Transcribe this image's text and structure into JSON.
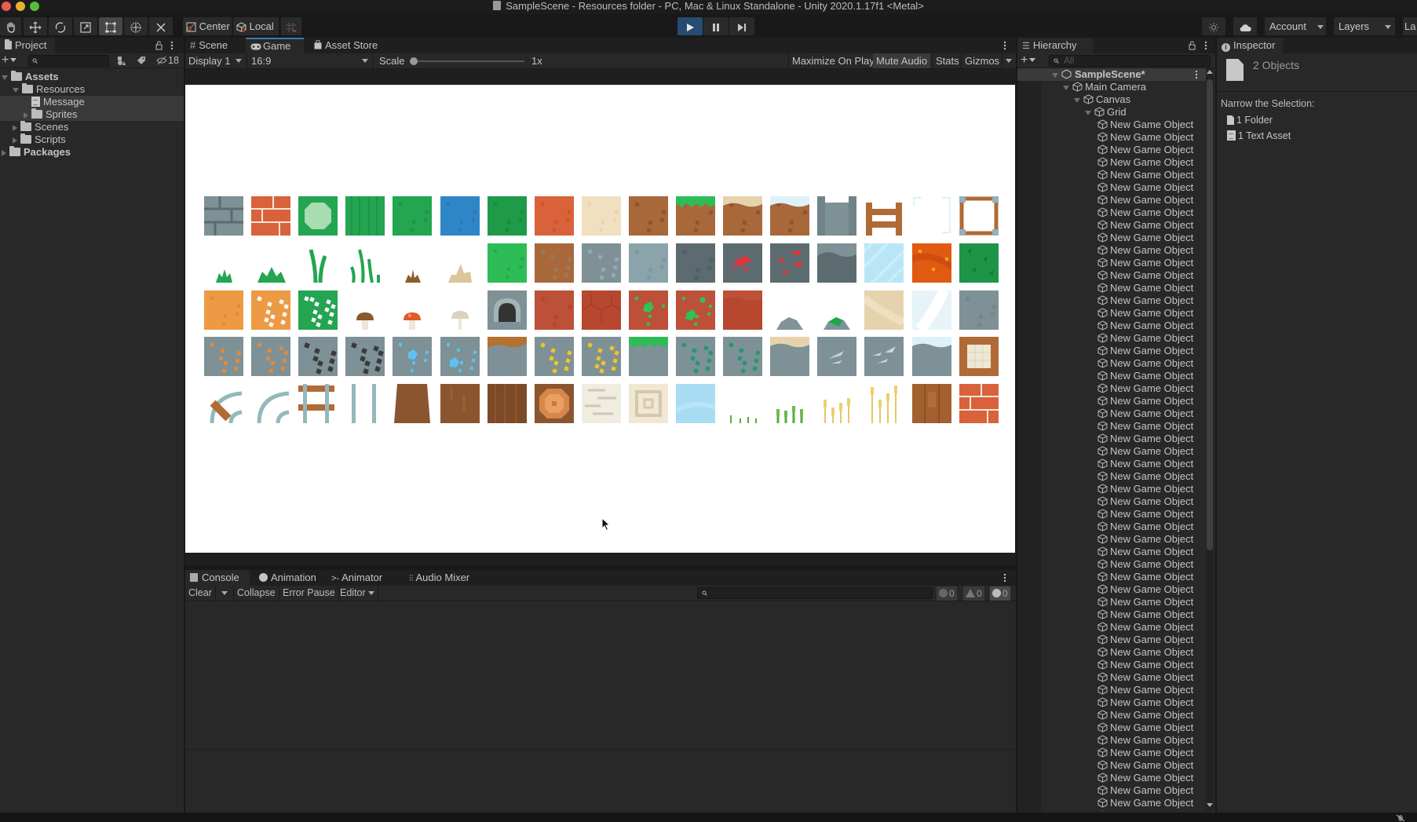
{
  "window": {
    "title": "SampleScene - Resources folder - PC, Mac & Linux Standalone - Unity 2020.1.17f1 <Metal>"
  },
  "toolbar": {
    "tools": [
      "hand-tool",
      "move-tool",
      "rotate-tool",
      "scale-tool",
      "rect-tool",
      "transform-tool",
      "custom-tool"
    ],
    "active_tool": "rect-tool",
    "pivot_label": "Center",
    "space_label": "Local",
    "play_state": "playing",
    "account_label": "Account",
    "layers_label": "Layers",
    "layout_label": "La"
  },
  "project": {
    "tab_label": "Project",
    "hidden_count": "18",
    "tree": [
      {
        "label": "Assets",
        "depth": 0,
        "expanded": true,
        "type": "folder",
        "bold": true
      },
      {
        "label": "Resources",
        "depth": 1,
        "expanded": true,
        "type": "folder"
      },
      {
        "label": "Message",
        "depth": 2,
        "type": "text",
        "selected": true
      },
      {
        "label": "Sprites",
        "depth": 2,
        "expanded": false,
        "type": "folder",
        "selected": true
      },
      {
        "label": "Scenes",
        "depth": 1,
        "expanded": false,
        "type": "folder"
      },
      {
        "label": "Scripts",
        "depth": 1,
        "expanded": false,
        "type": "folder"
      },
      {
        "label": "Packages",
        "depth": 0,
        "expanded": false,
        "type": "folder",
        "bold": true
      }
    ]
  },
  "center_tabs": [
    {
      "label": "Scene",
      "icon": "hash-icon"
    },
    {
      "label": "Game",
      "icon": "gamepad-icon",
      "selected": true
    },
    {
      "label": "Asset Store",
      "icon": "bag-icon"
    }
  ],
  "game_toolbar": {
    "display": "Display 1",
    "aspect": "16:9",
    "scale_label": "Scale",
    "scale_value": "1x",
    "maximize_on_play": "Maximize On Play",
    "mute_audio": "Mute Audio",
    "stats": "Stats",
    "gizmos": "Gizmos"
  },
  "game_view": {
    "tile_rows": [
      [
        "stone-brick",
        "red-brick",
        "green-gem",
        "grass-stripes",
        "grass",
        "water",
        "grass-dark",
        "dirt-red",
        "sand",
        "dirt",
        "dirt-grass-top",
        "dirt-sand-top",
        "dirt-snow-top",
        "stone-wall",
        "wood-fence",
        "ice-frame",
        "wood-frame"
      ],
      [
        "grass-tuft-small",
        "grass-tuft",
        "grass-blade",
        "grass-blades",
        "dry-tuft",
        "sand-tuft",
        "grass-bright",
        "dirt-rocks",
        "stone-rocks",
        "stone-light",
        "stone-dark",
        "stone-redore",
        "stone-redore-2",
        "stone-dark-top",
        "ice",
        "lava",
        "grass-leaf"
      ],
      [
        "orange-sand",
        "orange-white-dots",
        "green-white-dots",
        "mushroom-brown",
        "mushroom-red",
        "mushroom-tan",
        "stone-cave",
        "red-clay",
        "red-clay-hex",
        "red-green-gems",
        "red-green-gems-2",
        "red-clay-top",
        "rock-small",
        "rock-mossy",
        "sand-wave",
        "snow-wave",
        "stone-plain"
      ],
      [
        "stone-copper",
        "stone-copper-2",
        "stone-coal",
        "stone-coal-2",
        "stone-diamond",
        "stone-diamond-2",
        "stone-dirt-top",
        "stone-gold",
        "stone-gold-2",
        "stone-grass-top",
        "stone-emerald",
        "stone-emerald-2",
        "stone-sand-top",
        "stone-silver",
        "stone-silver-2",
        "stone-snow-top",
        "wood-window"
      ],
      [
        "rail-curve-plank",
        "rail-curve",
        "rail-plank",
        "rail-straight",
        "tree-trunk-base",
        "tree-trunk",
        "wood-bark",
        "tree-ring",
        "birch",
        "target-sand",
        "water-light",
        "sprout-small",
        "sprout",
        "wheat-small",
        "wheat-tall",
        "wood-planks",
        "red-brick-2"
      ]
    ]
  },
  "console": {
    "tabs": [
      {
        "label": "Console",
        "icon": "console-icon",
        "selected": true
      },
      {
        "label": "Animation",
        "icon": "clock-icon"
      },
      {
        "label": "Animator",
        "icon": "animator-icon"
      },
      {
        "label": "Audio Mixer",
        "icon": "mixer-icon"
      }
    ],
    "buttons": {
      "clear": "Clear",
      "collapse": "Collapse",
      "error_pause": "Error Pause",
      "editor": "Editor"
    },
    "counts": {
      "info": "0",
      "warning": "0",
      "error": "0"
    }
  },
  "hierarchy": {
    "tab_label": "Hierarchy",
    "search_placeholder": "All",
    "scene": "SampleScene*",
    "items": [
      {
        "label": "Main Camera",
        "depth": 1
      },
      {
        "label": "Canvas",
        "depth": 2
      },
      {
        "label": "Grid",
        "depth": 3
      }
    ],
    "child_label": "New Game Object",
    "child_count_visible": 55
  },
  "inspector": {
    "tab_label": "Inspector",
    "header": "2 Objects",
    "narrow_label": "Narrow the Selection:",
    "items": [
      {
        "label": "1 Folder",
        "icon": "folder-file-icon"
      },
      {
        "label": "1 Text Asset",
        "icon": "text-asset-icon"
      }
    ]
  },
  "colors": {
    "accent_blue": "#3a79bb",
    "play_active": "#274b72"
  }
}
